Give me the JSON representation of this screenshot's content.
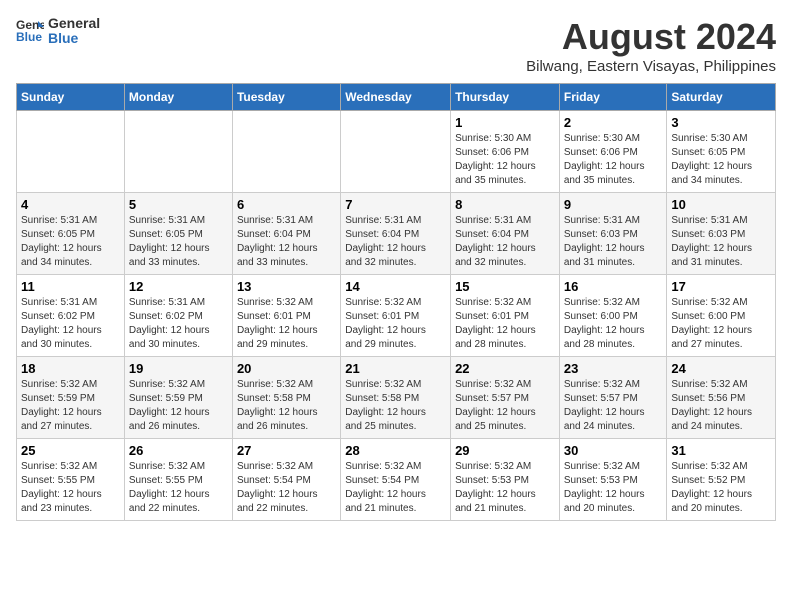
{
  "logo": {
    "line1": "General",
    "line2": "Blue"
  },
  "title": "August 2024",
  "subtitle": "Bilwang, Eastern Visayas, Philippines",
  "headers": [
    "Sunday",
    "Monday",
    "Tuesday",
    "Wednesday",
    "Thursday",
    "Friday",
    "Saturday"
  ],
  "weeks": [
    [
      {
        "num": "",
        "detail": ""
      },
      {
        "num": "",
        "detail": ""
      },
      {
        "num": "",
        "detail": ""
      },
      {
        "num": "",
        "detail": ""
      },
      {
        "num": "1",
        "detail": "Sunrise: 5:30 AM\nSunset: 6:06 PM\nDaylight: 12 hours\nand 35 minutes."
      },
      {
        "num": "2",
        "detail": "Sunrise: 5:30 AM\nSunset: 6:06 PM\nDaylight: 12 hours\nand 35 minutes."
      },
      {
        "num": "3",
        "detail": "Sunrise: 5:30 AM\nSunset: 6:05 PM\nDaylight: 12 hours\nand 34 minutes."
      }
    ],
    [
      {
        "num": "4",
        "detail": "Sunrise: 5:31 AM\nSunset: 6:05 PM\nDaylight: 12 hours\nand 34 minutes."
      },
      {
        "num": "5",
        "detail": "Sunrise: 5:31 AM\nSunset: 6:05 PM\nDaylight: 12 hours\nand 33 minutes."
      },
      {
        "num": "6",
        "detail": "Sunrise: 5:31 AM\nSunset: 6:04 PM\nDaylight: 12 hours\nand 33 minutes."
      },
      {
        "num": "7",
        "detail": "Sunrise: 5:31 AM\nSunset: 6:04 PM\nDaylight: 12 hours\nand 32 minutes."
      },
      {
        "num": "8",
        "detail": "Sunrise: 5:31 AM\nSunset: 6:04 PM\nDaylight: 12 hours\nand 32 minutes."
      },
      {
        "num": "9",
        "detail": "Sunrise: 5:31 AM\nSunset: 6:03 PM\nDaylight: 12 hours\nand 31 minutes."
      },
      {
        "num": "10",
        "detail": "Sunrise: 5:31 AM\nSunset: 6:03 PM\nDaylight: 12 hours\nand 31 minutes."
      }
    ],
    [
      {
        "num": "11",
        "detail": "Sunrise: 5:31 AM\nSunset: 6:02 PM\nDaylight: 12 hours\nand 30 minutes."
      },
      {
        "num": "12",
        "detail": "Sunrise: 5:31 AM\nSunset: 6:02 PM\nDaylight: 12 hours\nand 30 minutes."
      },
      {
        "num": "13",
        "detail": "Sunrise: 5:32 AM\nSunset: 6:01 PM\nDaylight: 12 hours\nand 29 minutes."
      },
      {
        "num": "14",
        "detail": "Sunrise: 5:32 AM\nSunset: 6:01 PM\nDaylight: 12 hours\nand 29 minutes."
      },
      {
        "num": "15",
        "detail": "Sunrise: 5:32 AM\nSunset: 6:01 PM\nDaylight: 12 hours\nand 28 minutes."
      },
      {
        "num": "16",
        "detail": "Sunrise: 5:32 AM\nSunset: 6:00 PM\nDaylight: 12 hours\nand 28 minutes."
      },
      {
        "num": "17",
        "detail": "Sunrise: 5:32 AM\nSunset: 6:00 PM\nDaylight: 12 hours\nand 27 minutes."
      }
    ],
    [
      {
        "num": "18",
        "detail": "Sunrise: 5:32 AM\nSunset: 5:59 PM\nDaylight: 12 hours\nand 27 minutes."
      },
      {
        "num": "19",
        "detail": "Sunrise: 5:32 AM\nSunset: 5:59 PM\nDaylight: 12 hours\nand 26 minutes."
      },
      {
        "num": "20",
        "detail": "Sunrise: 5:32 AM\nSunset: 5:58 PM\nDaylight: 12 hours\nand 26 minutes."
      },
      {
        "num": "21",
        "detail": "Sunrise: 5:32 AM\nSunset: 5:58 PM\nDaylight: 12 hours\nand 25 minutes."
      },
      {
        "num": "22",
        "detail": "Sunrise: 5:32 AM\nSunset: 5:57 PM\nDaylight: 12 hours\nand 25 minutes."
      },
      {
        "num": "23",
        "detail": "Sunrise: 5:32 AM\nSunset: 5:57 PM\nDaylight: 12 hours\nand 24 minutes."
      },
      {
        "num": "24",
        "detail": "Sunrise: 5:32 AM\nSunset: 5:56 PM\nDaylight: 12 hours\nand 24 minutes."
      }
    ],
    [
      {
        "num": "25",
        "detail": "Sunrise: 5:32 AM\nSunset: 5:55 PM\nDaylight: 12 hours\nand 23 minutes."
      },
      {
        "num": "26",
        "detail": "Sunrise: 5:32 AM\nSunset: 5:55 PM\nDaylight: 12 hours\nand 22 minutes."
      },
      {
        "num": "27",
        "detail": "Sunrise: 5:32 AM\nSunset: 5:54 PM\nDaylight: 12 hours\nand 22 minutes."
      },
      {
        "num": "28",
        "detail": "Sunrise: 5:32 AM\nSunset: 5:54 PM\nDaylight: 12 hours\nand 21 minutes."
      },
      {
        "num": "29",
        "detail": "Sunrise: 5:32 AM\nSunset: 5:53 PM\nDaylight: 12 hours\nand 21 minutes."
      },
      {
        "num": "30",
        "detail": "Sunrise: 5:32 AM\nSunset: 5:53 PM\nDaylight: 12 hours\nand 20 minutes."
      },
      {
        "num": "31",
        "detail": "Sunrise: 5:32 AM\nSunset: 5:52 PM\nDaylight: 12 hours\nand 20 minutes."
      }
    ]
  ]
}
